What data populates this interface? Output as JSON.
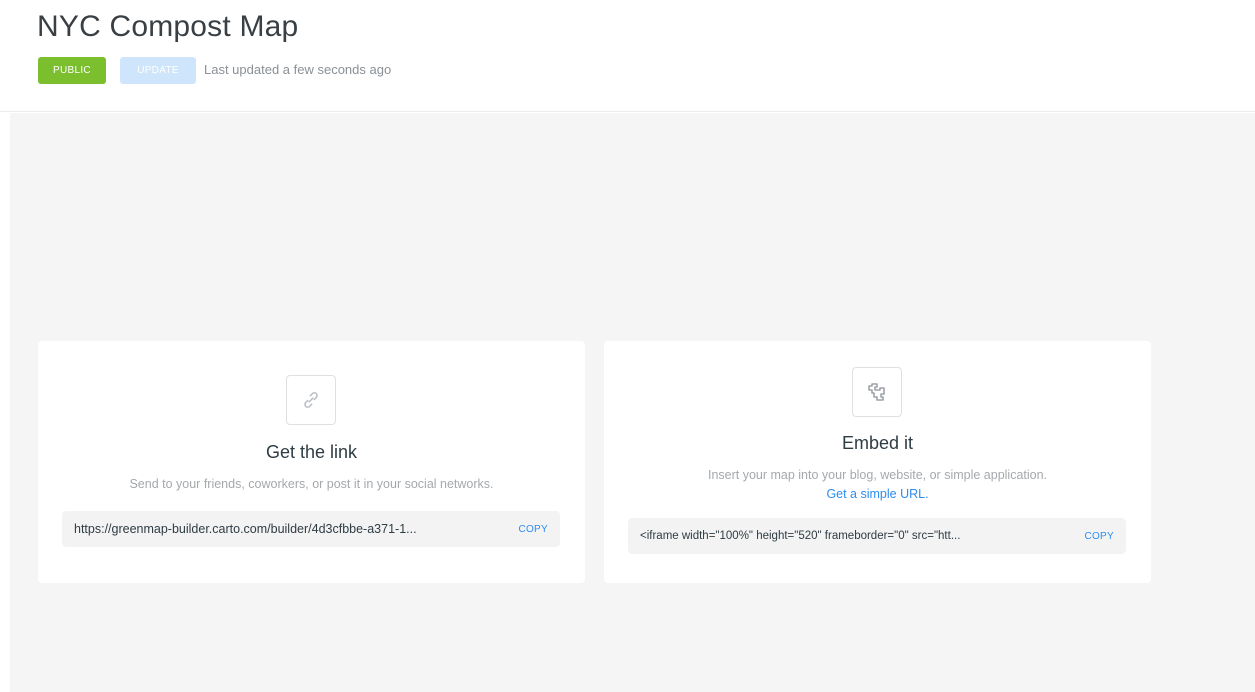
{
  "header": {
    "title": "NYC Compost Map",
    "public_label": "PUBLIC",
    "update_label": "UPDATE",
    "last_updated": "Last updated a few seconds ago"
  },
  "link_card": {
    "icon": "link-icon",
    "heading": "Get the link",
    "description": "Send to your friends, coworkers, or post it in your social networks.",
    "url_value": "https://greenmap-builder.carto.com/builder/4d3cfbbe-a371-1...",
    "copy_label": "COPY"
  },
  "embed_card": {
    "icon": "embed-icon",
    "heading": "Embed it",
    "description": "Insert your map into your blog, website, or simple application.",
    "simple_url_link": "Get a simple URL.",
    "embed_value": "<iframe width=\"100%\" height=\"520\" frameborder=\"0\" src=\"htt...",
    "copy_label": "COPY"
  },
  "colors": {
    "public_badge": "#7bbf2e",
    "update_badge": "#cfe5fb",
    "link_blue": "#2d8cf0",
    "background": "#f5f5f5"
  }
}
